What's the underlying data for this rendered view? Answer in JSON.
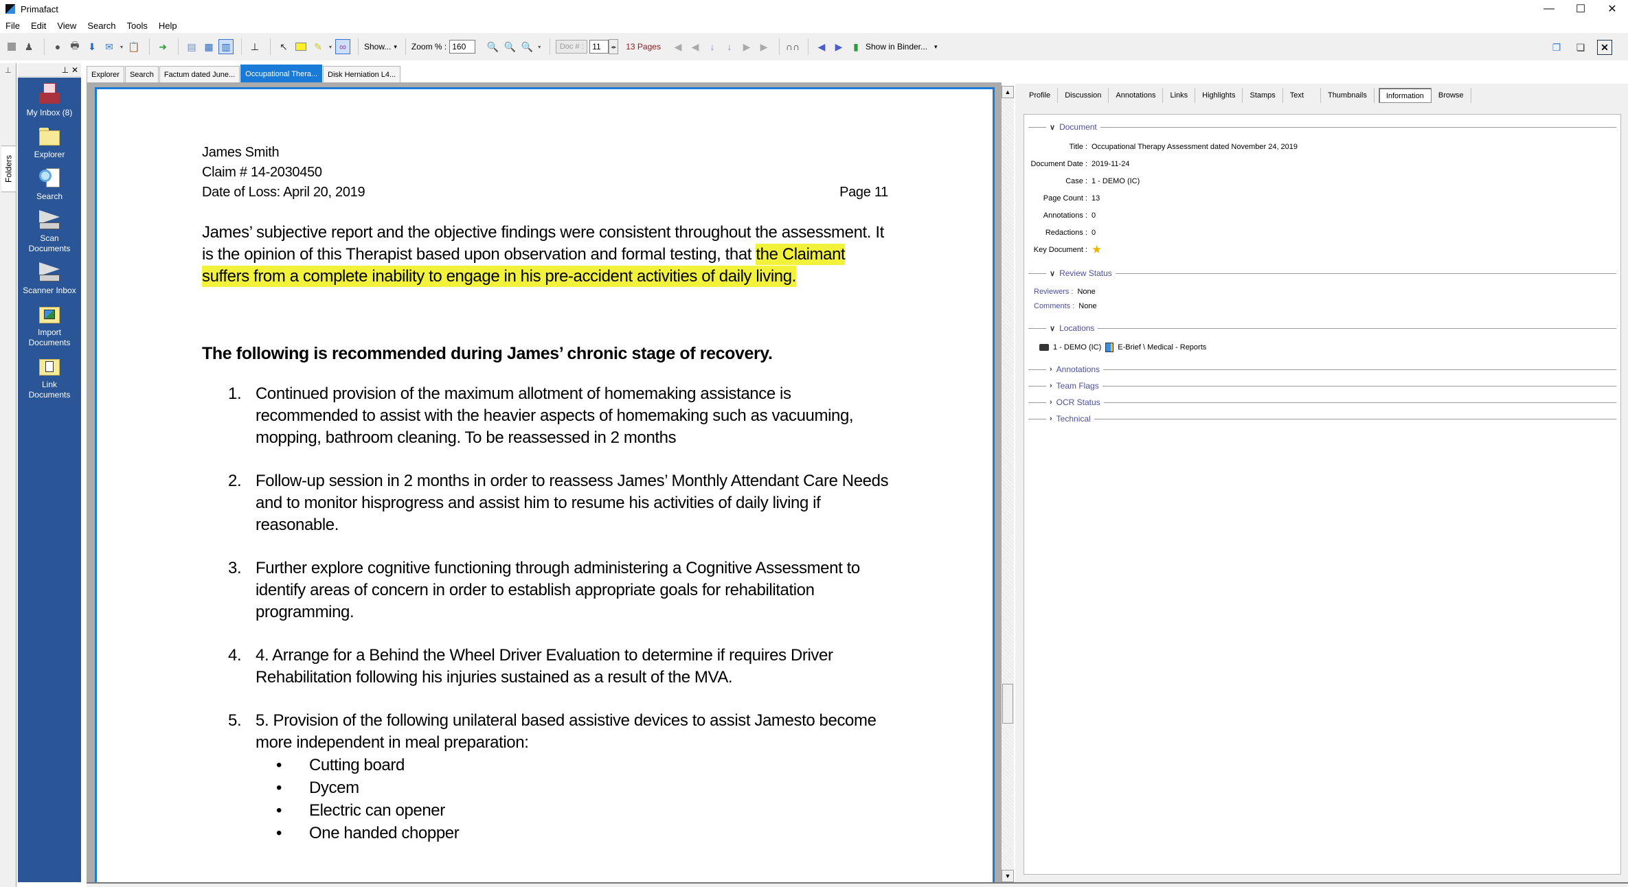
{
  "window": {
    "title": "Primafact",
    "controls": {
      "minimize": "—",
      "maximize": "☐",
      "close": "✕"
    }
  },
  "menu": [
    "File",
    "Edit",
    "View",
    "Search",
    "Tools",
    "Help"
  ],
  "toolbar": {
    "show_label": "Show...",
    "zoom_label": "Zoom % :",
    "zoom_value": "160",
    "doc_label": "Doc # :",
    "doc_value": "11",
    "page_count_label": "13 Pages",
    "show_in_binder_label": "Show in Binder..."
  },
  "left_strip": {
    "folders_tab": "Folders"
  },
  "sidebar": {
    "items": [
      {
        "label": "My Inbox (8)",
        "icon": "inbox-icon"
      },
      {
        "label": "Explorer",
        "icon": "folder-icon"
      },
      {
        "label": "Search",
        "icon": "search-document-icon"
      },
      {
        "label": "Scan Documents",
        "icon": "scanner-icon"
      },
      {
        "label": "Scanner Inbox",
        "icon": "scanner-icon"
      },
      {
        "label": "Import Documents",
        "icon": "import-folder-icon"
      },
      {
        "label": "Link Documents",
        "icon": "link-folder-icon"
      }
    ]
  },
  "doc_tabs": [
    {
      "label": "Explorer",
      "active": false
    },
    {
      "label": "Search",
      "active": false
    },
    {
      "label": "Factum dated June...",
      "active": false
    },
    {
      "label": "Occupational Thera...",
      "active": true
    },
    {
      "label": "Disk Herniation L4...",
      "active": false
    }
  ],
  "document": {
    "header": {
      "name": "James Smith",
      "claim": "Claim # 14-2030450",
      "date_of_loss": "Date of Loss: April 20, 2019",
      "page": "Page 11"
    },
    "paragraph_plain": "James’ subjective report and the objective findings were consistent throughout the assessment. It is the opinion of this Therapist based upon observation and formal testing, that ",
    "paragraph_highlighted": "the Claimant suffers from a complete inability to engage in his pre-accident activities of daily living.",
    "highlight_color": "#f2f23a",
    "recommendation_heading": "The following is recommended during James’ chronic stage of recovery.",
    "recommendations": [
      {
        "num": "1.",
        "text": "Continued provision of the maximum allotment of homemaking assistance is recommended to assist with the heavier aspects of homemaking such as vacuuming, mopping, bathroom cleaning. To be reassessed in 2 months"
      },
      {
        "num": "2.",
        "text": "Follow-up session in 2 months in order to reassess James’ Monthly Attendant Care Needs and to monitor hisprogress and assist him to resume his activities of daily living if reasonable."
      },
      {
        "num": "3.",
        "text": "Further explore cognitive functioning through administering a Cognitive Assessment to identify areas of concern in order to establish appropriate goals for rehabilitation programming."
      },
      {
        "num": "4.",
        "text": "4. Arrange for a Behind the Wheel Driver Evaluation to determine if requires Driver Rehabilitation following his injuries sustained as a result of the MVA."
      },
      {
        "num": "5.",
        "text": "5. Provision of the following unilateral based assistive devices to assist Jamesto become more independent in meal preparation:"
      }
    ],
    "devices": [
      "Cutting board",
      "Dycem",
      "Electric can opener",
      "One handed chopper"
    ],
    "scroll_position_fraction": 0.8
  },
  "right_panel": {
    "tabs": [
      {
        "label": "Profile",
        "active": false
      },
      {
        "label": "Discussion",
        "active": false
      },
      {
        "label": "Annotations",
        "active": false
      },
      {
        "label": "Links",
        "active": false
      },
      {
        "label": "Highlights",
        "active": false
      },
      {
        "label": "Stamps",
        "active": false
      },
      {
        "label": "Text",
        "active": false
      },
      {
        "label": "Thumbnails",
        "active": false
      },
      {
        "label": "Information",
        "active": true
      },
      {
        "label": "Browse",
        "active": false
      }
    ],
    "document_section": {
      "title": "Document",
      "fields": [
        {
          "key": "Title :",
          "value": "Occupational Therapy Assessment dated November 24, 2019"
        },
        {
          "key": "Document Date :",
          "value": "2019-11-24"
        },
        {
          "key": "Case :",
          "value": "1 - DEMO (IC)"
        },
        {
          "key": "Page Count :",
          "value": "13"
        },
        {
          "key": "Annotations :",
          "value": "0"
        },
        {
          "key": "Redactions :",
          "value": "0"
        },
        {
          "key": "Key Document :",
          "value": "★"
        }
      ]
    },
    "review_section": {
      "title": "Review Status",
      "fields": [
        {
          "key": "Reviewers :",
          "value": "None"
        },
        {
          "key": "Comments :",
          "value": "None"
        }
      ]
    },
    "locations_section": {
      "title": "Locations",
      "case": "1 - DEMO (IC)",
      "binder_path": "E-Brief \\ Medical - Reports"
    },
    "collapsed_sections": [
      "Annotations",
      "Team Flags",
      "OCR Status",
      "Technical"
    ]
  }
}
